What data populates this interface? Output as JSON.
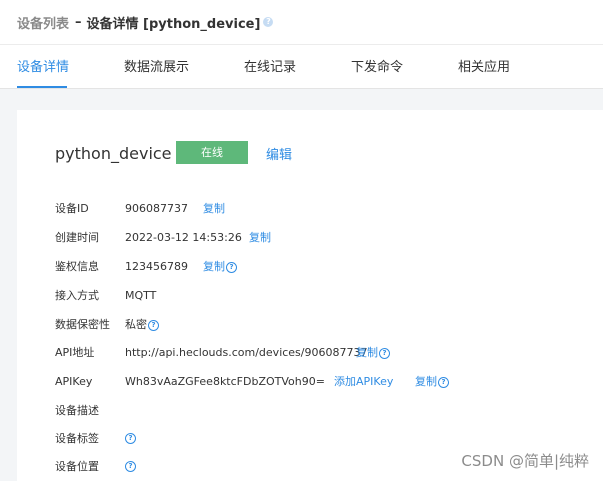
{
  "breadcrumb": {
    "parent": "设备列表",
    "separator": "–",
    "current": "设备详情 [python_device]",
    "help_icon": "question-icon"
  },
  "tabs": [
    {
      "label": "设备详情",
      "active": true
    },
    {
      "label": "数据流展示",
      "active": false
    },
    {
      "label": "在线记录",
      "active": false
    },
    {
      "label": "下发命令",
      "active": false
    },
    {
      "label": "相关应用",
      "active": false
    }
  ],
  "device": {
    "name": "python_device",
    "status": "在线",
    "edit_label": "编辑"
  },
  "details": {
    "device_id": {
      "label": "设备ID",
      "value": "906087737",
      "action": "复制"
    },
    "created_time": {
      "label": "创建时间",
      "value": "2022-03-12 14:53:26",
      "action": "复制"
    },
    "auth_info": {
      "label": "鉴权信息",
      "value": "123456789",
      "action": "复制"
    },
    "protocol": {
      "label": "接入方式",
      "value": "MQTT"
    },
    "privacy": {
      "label": "数据保密性",
      "value": "私密"
    },
    "api_address": {
      "label": "API地址",
      "value": "http://api.heclouds.com/devices/906087737",
      "action": "复制"
    },
    "api_key": {
      "label": "APIKey",
      "value": "Wh83vAaZGFee8ktcFDbZOTVoh90=",
      "add_action": "添加APIKey",
      "action": "复制"
    },
    "description": {
      "label": "设备描述"
    },
    "tags": {
      "label": "设备标签"
    },
    "location": {
      "label": "设备位置"
    }
  },
  "help_glyph": "?",
  "watermark": "CSDN @简单|纯粹",
  "colors": {
    "accent": "#2f8ce3",
    "online": "#5eb87a",
    "background": "#f3f5f7"
  }
}
